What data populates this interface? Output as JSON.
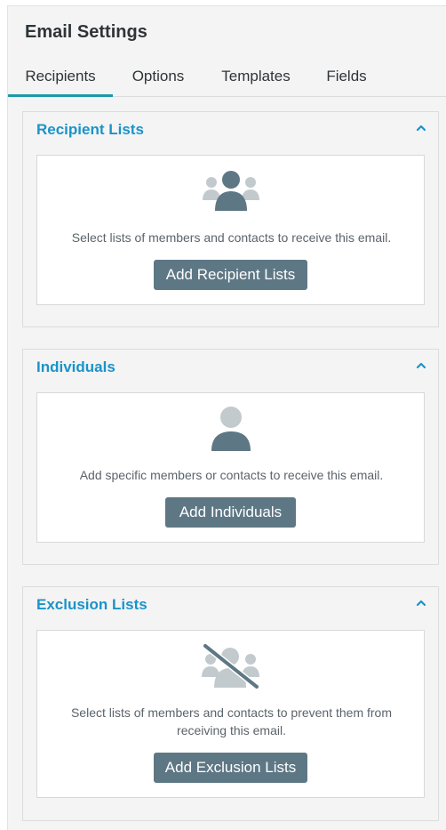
{
  "header": {
    "title": "Email Settings"
  },
  "tabs": [
    {
      "label": "Recipients",
      "active": true
    },
    {
      "label": "Options",
      "active": false
    },
    {
      "label": "Templates",
      "active": false
    },
    {
      "label": "Fields",
      "active": false
    }
  ],
  "sections": {
    "recipient_lists": {
      "title": "Recipient Lists",
      "icon": "users-group-icon",
      "description": "Select lists of members and contacts to receive this email.",
      "button_label": "Add Recipient Lists"
    },
    "individuals": {
      "title": "Individuals",
      "icon": "user-icon",
      "description": "Add specific members or contacts to receive this email.",
      "button_label": "Add Individuals"
    },
    "exclusion_lists": {
      "title": "Exclusion Lists",
      "icon": "users-group-slash-icon",
      "description_line1": "Select lists of members and contacts to prevent them from",
      "description_line2": "receiving this email.",
      "button_label": "Add Exclusion Lists"
    }
  },
  "colors": {
    "accent_tab": "#1b9aa6",
    "section_title": "#1b93c9",
    "button": "#5e7785",
    "icon_dark": "#5e7785",
    "icon_light": "#c3cace"
  }
}
